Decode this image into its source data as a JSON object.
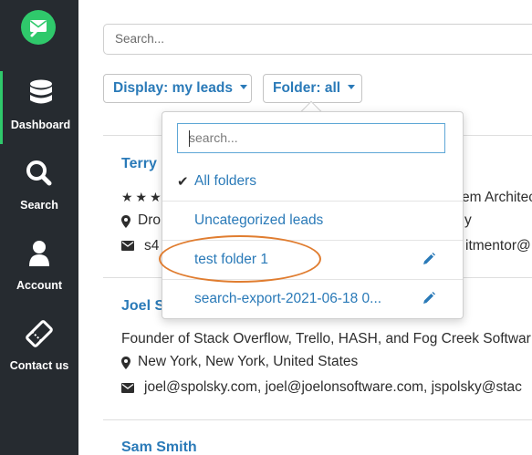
{
  "sidebar": {
    "logo_icon": "mail-search-icon",
    "items": [
      {
        "label": "Dashboard",
        "icon": "database-icon",
        "active": true
      },
      {
        "label": "Search",
        "icon": "search-icon",
        "active": false
      },
      {
        "label": "Account",
        "icon": "user-icon",
        "active": false
      },
      {
        "label": "Contact us",
        "icon": "ticket-icon",
        "active": false
      }
    ]
  },
  "main": {
    "search_placeholder": "Search...",
    "display_filter": "Display: my leads",
    "folder_filter": "Folder: all",
    "leads": [
      {
        "name": "Terry",
        "title_fragment": "em Architec",
        "location_fragment": "Dro",
        "location_fragment_right": "y",
        "email_fragment": "s4",
        "email_fragment_right": "itmentor@"
      },
      {
        "name": "Joel S",
        "title": "Founder of Stack Overflow, Trello, HASH, and Fog Creek Softwar",
        "location": "New York, New York, United States",
        "emails": "joel@spolsky.com, joel@joelonsoftware.com, jspolsky@stac"
      },
      {
        "name": "Sam Smith"
      }
    ]
  },
  "folder_dropdown": {
    "search_placeholder": "search...",
    "items": [
      {
        "label": "All folders",
        "checked": true,
        "editable": false
      },
      {
        "label": "Uncategorized leads",
        "checked": false,
        "editable": false
      },
      {
        "label": "test folder 1",
        "checked": false,
        "editable": true,
        "highlighted": true
      },
      {
        "label": "search-export-2021-06-18 0...",
        "checked": false,
        "editable": true
      }
    ]
  },
  "colors": {
    "sidebar_bg": "#262b30",
    "accent_green": "#2fc96b",
    "link_blue": "#2a7ab8",
    "highlight_orange": "#e07d30"
  }
}
